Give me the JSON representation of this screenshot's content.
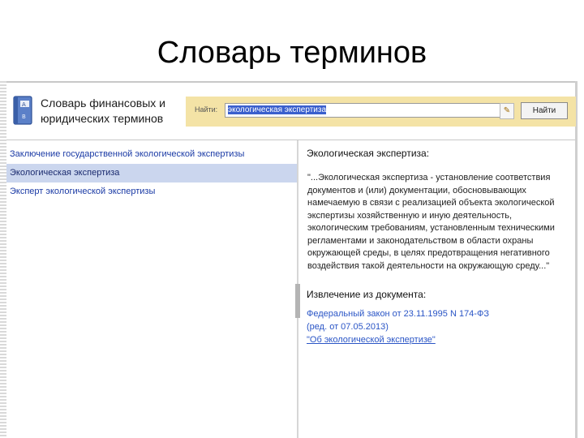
{
  "slide": {
    "title": "Словарь терминов"
  },
  "app": {
    "title_line1": "Словарь финансовых и",
    "title_line2": "юридических терминов"
  },
  "search": {
    "label": "Найти:",
    "value": "экологическая экспертиза",
    "find_button": "Найти"
  },
  "terms": [
    {
      "label": "Заключение государственной экологической экспертизы"
    },
    {
      "label": "Экологическая экспертиза"
    },
    {
      "label": "Эксперт экологической экспертизы"
    }
  ],
  "detail": {
    "heading": "Экологическая экспертиза:",
    "definition": "\"...Экологическая экспертиза - установление соответствия документов и (или) документации, обосновывающих намечаемую в связи с реализацией объекта экологической экспертизы хозяйственную и иную деятельность, экологическим требованиям, установленным техническими регламентами и законодательством в области охраны окружающей среды, в целях предотвращения негативного воздействия такой деятельности на окружающую среду...\"",
    "extract_heading": "Извлечение из документа:",
    "source": {
      "line1": "Федеральный закон от 23.11.1995 N 174-ФЗ",
      "line2": "(ред. от 07.05.2013)",
      "line3": "\"Об экологической экспертизе\""
    }
  },
  "colors": {
    "search_bar_bg": "#f4e3a6",
    "selection_bg": "#cbd6ee",
    "link": "#2a55c6"
  },
  "icons": {
    "app": "dictionary-book-icon",
    "clear": "clear-search-icon"
  }
}
